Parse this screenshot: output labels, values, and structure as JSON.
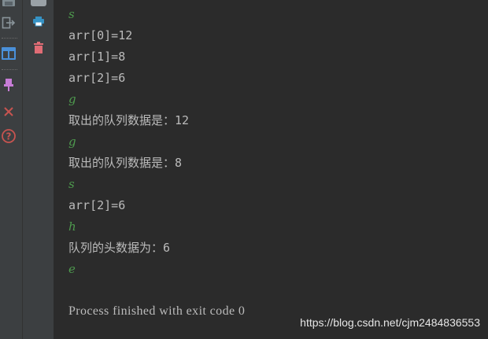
{
  "toolbar": {
    "rail1_icons": [
      "save-icon",
      "exit-icon",
      "layout-icon",
      "pin-icon",
      "close-icon",
      "help-icon"
    ],
    "rail2_icons": [
      "scroll-icon",
      "print-icon",
      "trash-icon"
    ],
    "colors": {
      "close": "#c75450",
      "help": "#c75450",
      "pin": "#c77dd7",
      "print": "#3592c4",
      "trash": "#e06c75",
      "layout": "#4a90d9"
    }
  },
  "console": {
    "lines": [
      {
        "text": "s",
        "kind": "input"
      },
      {
        "text": "arr[0]=12",
        "kind": "output"
      },
      {
        "text": "arr[1]=8",
        "kind": "output"
      },
      {
        "text": "arr[2]=6",
        "kind": "output"
      },
      {
        "text": "g",
        "kind": "input"
      },
      {
        "text": "取出的队列数据是：12",
        "kind": "output"
      },
      {
        "text": "g",
        "kind": "input"
      },
      {
        "text": "取出的队列数据是：8",
        "kind": "output"
      },
      {
        "text": "s",
        "kind": "input"
      },
      {
        "text": "arr[2]=6",
        "kind": "output"
      },
      {
        "text": "h",
        "kind": "input"
      },
      {
        "text": "队列的头数据为：6",
        "kind": "output"
      },
      {
        "text": "e",
        "kind": "input"
      }
    ],
    "process_message": "Process finished with exit code 0"
  },
  "watermark": "https://blog.csdn.net/cjm2484836553"
}
